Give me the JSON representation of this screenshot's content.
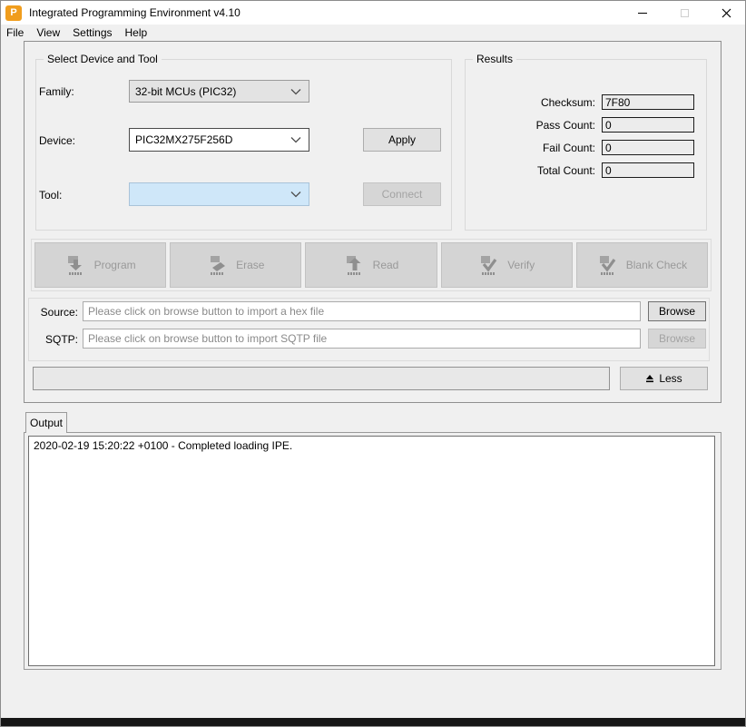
{
  "window": {
    "title": "Integrated Programming Environment v4.10",
    "app_icon_letter": "P"
  },
  "icons": {
    "app-logo-icon": "orange rounded square with white P",
    "minimize-icon": "–",
    "maximize-icon": "▢",
    "close-icon": "✕",
    "chevron-down-icon": "⌄",
    "less-eject-icon": "⏏",
    "program-icon": "chip with down arrow",
    "erase-icon": "chip with eraser",
    "read-icon": "chip with up arrow",
    "verify-icon": "chip with checkmark",
    "blank-check-icon": "chip with checkmark"
  },
  "colors": {
    "accent_orange": "#f09d1d",
    "tool_field_blue": "#cfe7f9",
    "disabled_text": "#a3a3a3",
    "window_bg": "#f0f0f0",
    "bottom_bar": "#161616"
  },
  "menu": {
    "items": [
      "File",
      "View",
      "Settings",
      "Help"
    ]
  },
  "device_tool": {
    "group_title": "Select Device and Tool",
    "family_label": "Family:",
    "family_value": "32-bit MCUs (PIC32)",
    "device_label": "Device:",
    "device_value": "PIC32MX275F256D",
    "tool_label": "Tool:",
    "tool_value": "",
    "apply_label": "Apply",
    "connect_label": "Connect"
  },
  "results": {
    "group_title": "Results",
    "rows": [
      {
        "label": "Checksum:",
        "value": "7F80"
      },
      {
        "label": "Pass Count:",
        "value": "0"
      },
      {
        "label": "Fail Count:",
        "value": "0"
      },
      {
        "label": "Total Count:",
        "value": "0"
      }
    ]
  },
  "actions": {
    "buttons": [
      {
        "label": "Program"
      },
      {
        "label": "Erase"
      },
      {
        "label": "Read"
      },
      {
        "label": "Verify"
      },
      {
        "label": "Blank Check"
      }
    ]
  },
  "files": {
    "source_label": "Source:",
    "source_placeholder": "Please click on browse button to import a hex file",
    "sqtp_label": "SQTP:",
    "sqtp_placeholder": "Please click on browse button to import SQTP file",
    "browse_source_label": "Browse",
    "browse_sqtp_label": "Browse"
  },
  "progress": {
    "percent": 0,
    "less_label": "Less"
  },
  "output": {
    "tab_label": "Output",
    "log_lines": [
      "2020-02-19 15:20:22 +0100 - Completed loading IPE."
    ]
  }
}
